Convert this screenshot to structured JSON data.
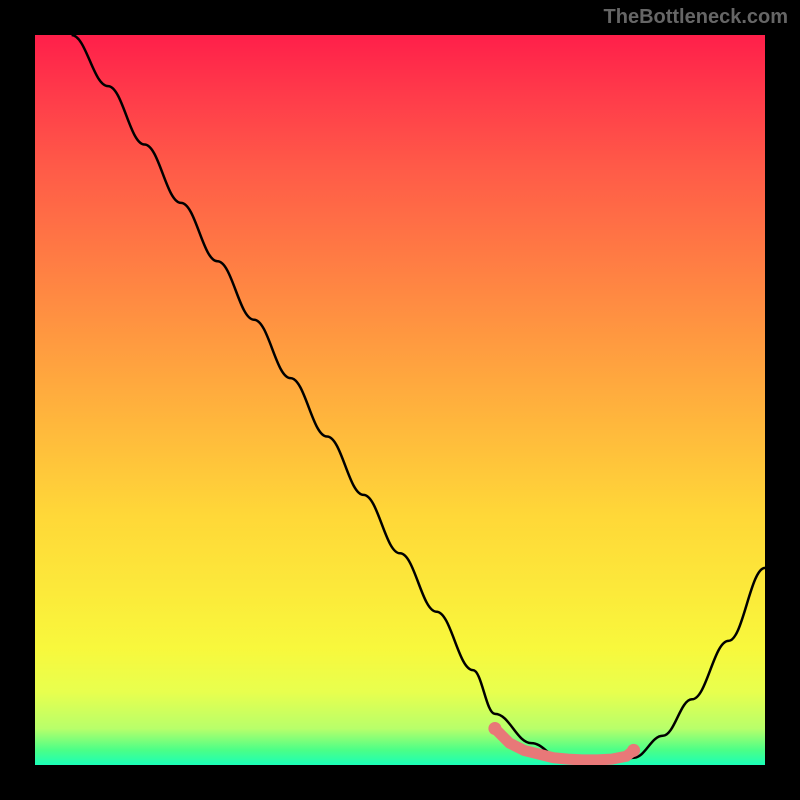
{
  "watermark": "TheBottleneck.com",
  "chart_data": {
    "type": "line",
    "title": "",
    "xlabel": "",
    "ylabel": "",
    "xlim": [
      0,
      100
    ],
    "ylim": [
      0,
      100
    ],
    "series": [
      {
        "name": "bottleneck-curve",
        "color": "#000000",
        "x": [
          5,
          10,
          15,
          20,
          25,
          30,
          35,
          40,
          45,
          50,
          55,
          60,
          63,
          68,
          72,
          76,
          80,
          82,
          86,
          90,
          95,
          100
        ],
        "y": [
          100,
          93,
          85,
          77,
          69,
          61,
          53,
          45,
          37,
          29,
          21,
          13,
          7,
          3,
          1,
          0.5,
          0.5,
          1,
          4,
          9,
          17,
          27
        ]
      },
      {
        "name": "optimal-marker",
        "color": "#e87878",
        "type": "scatter",
        "x": [
          63,
          65,
          67,
          69,
          71,
          73,
          75,
          77,
          79,
          81,
          82
        ],
        "y": [
          5,
          3,
          2,
          1.5,
          1,
          0.8,
          0.7,
          0.7,
          0.8,
          1.2,
          2
        ]
      }
    ],
    "gradient_stops": [
      {
        "pos": 0,
        "color": "#ff1f4a"
      },
      {
        "pos": 50,
        "color": "#ffb000"
      },
      {
        "pos": 85,
        "color": "#f8f83c"
      },
      {
        "pos": 100,
        "color": "#1affb8"
      }
    ]
  }
}
